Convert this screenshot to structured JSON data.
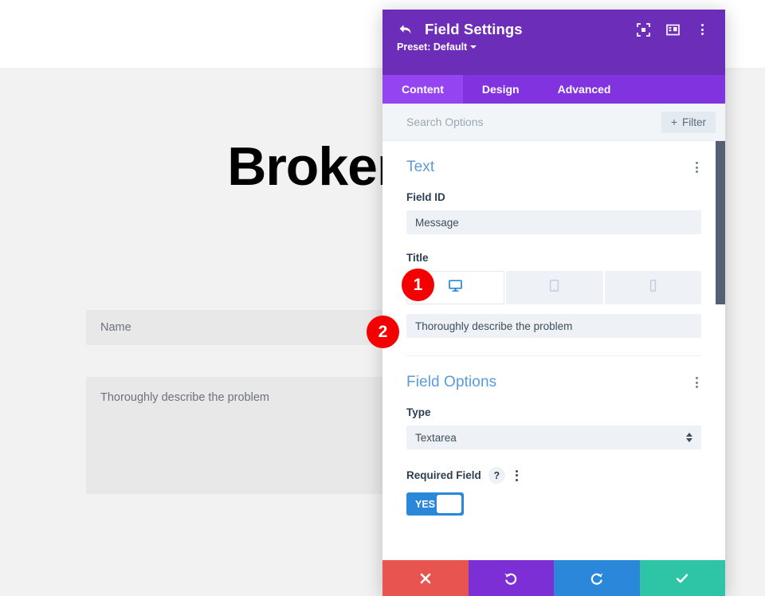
{
  "background_page": {
    "heading": "Broken Data",
    "form": {
      "name_placeholder": "Name",
      "message_placeholder": "Thoroughly describe the problem"
    }
  },
  "modal": {
    "title": "Field Settings",
    "back_icon": "back-arrow-icon",
    "preset_label": "Preset: Default",
    "header_icons": [
      {
        "name": "focus-target-icon"
      },
      {
        "name": "layout-panel-icon"
      },
      {
        "name": "more-options-icon"
      }
    ],
    "tabs": [
      {
        "label": "Content",
        "active": true
      },
      {
        "label": "Design",
        "active": false
      },
      {
        "label": "Advanced",
        "active": false
      }
    ],
    "search": {
      "placeholder": "Search Options",
      "value": "",
      "filter_label": "Filter",
      "filter_plus": "+"
    },
    "sections": [
      {
        "title": "Text",
        "fields": [
          {
            "label": "Field ID",
            "value": "Message"
          },
          {
            "label": "Title",
            "value": "Thoroughly describe the problem",
            "devices": [
              {
                "name": "desktop-icon",
                "active": true
              },
              {
                "name": "tablet-icon",
                "active": false
              },
              {
                "name": "phone-icon",
                "active": false
              }
            ]
          }
        ]
      },
      {
        "title": "Field Options",
        "type_label": "Type",
        "type_value": "Textarea",
        "required_label": "Required Field",
        "required_help": "?",
        "required_toggle": "YES"
      }
    ],
    "footer_actions": [
      {
        "name": "cancel-button",
        "glyph": "✖",
        "color": "#e8544f"
      },
      {
        "name": "undo-button",
        "glyph": "↺",
        "color": "#7b2fd4"
      },
      {
        "name": "redo-button",
        "glyph": "↻",
        "color": "#2b87da"
      },
      {
        "name": "save-button",
        "glyph": "✔",
        "color": "#2ec4a6"
      }
    ]
  },
  "annotations": {
    "badges": [
      {
        "number": "1"
      },
      {
        "number": "2"
      }
    ]
  },
  "colors": {
    "header_purple": "#6c2eb9",
    "tab_purple": "#8133e0",
    "tab_active_purple": "#9444f0",
    "section_title_blue": "#5a9bdc",
    "toggle_blue": "#2b87da",
    "badge_red": "#f40000",
    "scrollbar_slate": "#546073"
  }
}
